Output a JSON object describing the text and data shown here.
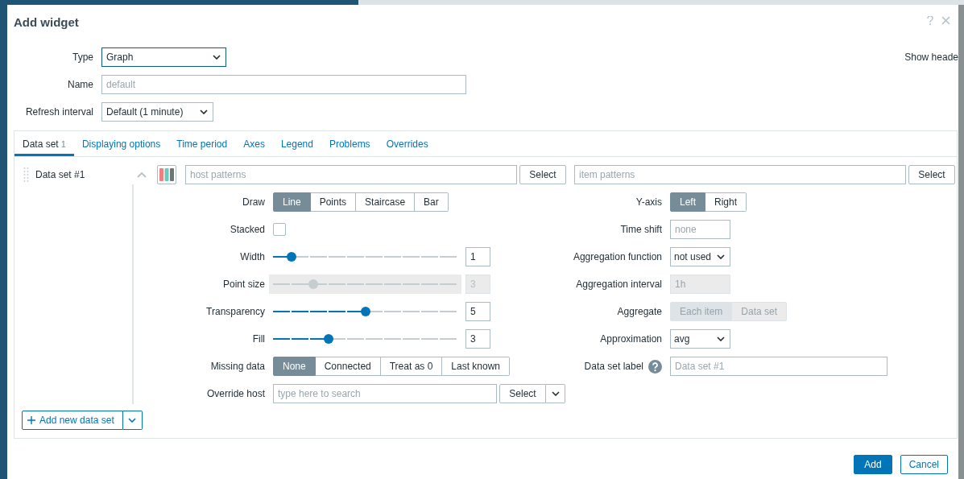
{
  "dialog": {
    "title": "Add widget"
  },
  "form": {
    "type": {
      "label": "Type",
      "value": "Graph"
    },
    "name": {
      "label": "Name",
      "placeholder": "default"
    },
    "refresh": {
      "label": "Refresh interval",
      "value": "Default (1 minute)"
    },
    "show_header": {
      "label": "Show heade"
    }
  },
  "tabs": [
    {
      "label": "Data set",
      "count": "1",
      "selected": true
    },
    {
      "label": "Displaying options",
      "selected": false
    },
    {
      "label": "Time period",
      "selected": false
    },
    {
      "label": "Axes",
      "selected": false
    },
    {
      "label": "Legend",
      "selected": false
    },
    {
      "label": "Problems",
      "selected": false
    },
    {
      "label": "Overrides",
      "selected": false
    }
  ],
  "data_sets": [
    {
      "label": "Data set #1",
      "expanded": true
    }
  ],
  "add_data_set": {
    "label": "Add new data set"
  },
  "data_set": {
    "host": {
      "placeholder": "host patterns",
      "button": "Select"
    },
    "item": {
      "placeholder": "item patterns",
      "button": "Select"
    },
    "left_fields": [
      {
        "kind": "segmented",
        "label": "Draw",
        "options": [
          {
            "label": "Line",
            "selected": true
          },
          {
            "label": "Points",
            "selected": false
          },
          {
            "label": "Staircase",
            "selected": false
          },
          {
            "label": "Bar",
            "selected": false
          }
        ]
      },
      {
        "kind": "checkbox",
        "label": "Stacked",
        "checked": false
      },
      {
        "kind": "slider",
        "label": "Width",
        "level": 0.1,
        "value": "1"
      },
      {
        "kind": "slider",
        "label": "Point size",
        "level": 0.22,
        "value": "3",
        "disabled": true
      },
      {
        "kind": "slider",
        "label": "Transparency",
        "level": 0.5,
        "value": "5"
      },
      {
        "kind": "slider",
        "label": "Fill",
        "level": 0.3,
        "value": "3"
      },
      {
        "kind": "segmented",
        "label": "Missing data",
        "options": [
          {
            "label": "None",
            "selected": true
          },
          {
            "label": "Connected",
            "selected": false
          },
          {
            "label": "Treat as 0",
            "selected": false
          },
          {
            "label": "Last known",
            "selected": false
          }
        ]
      },
      {
        "kind": "search",
        "label": "Override host",
        "placeholder": "type here to search",
        "button": "Select"
      }
    ],
    "right_fields": [
      {
        "kind": "segmented",
        "label": "Y-axis",
        "options": [
          {
            "label": "Left",
            "selected": true
          },
          {
            "label": "Right",
            "selected": false
          }
        ]
      },
      {
        "kind": "input",
        "label": "Time shift",
        "placeholder": "none"
      },
      {
        "kind": "select",
        "label": "Aggregation function",
        "value": "not used"
      },
      {
        "kind": "input",
        "label": "Aggregation interval",
        "placeholder": "1h",
        "disabled": true
      },
      {
        "kind": "segmented",
        "label": "Aggregate",
        "disabled": true,
        "options": [
          {
            "label": "Each item",
            "selected": true
          },
          {
            "label": "Data set",
            "selected": false
          }
        ]
      },
      {
        "kind": "select",
        "label": "Approximation",
        "value": "avg"
      },
      {
        "kind": "text",
        "label": "Data set label",
        "placeholder": "Data set #1",
        "help": true
      }
    ]
  },
  "footer": {
    "buttons": [
      {
        "label": "Add",
        "primary": true
      },
      {
        "label": "Cancel",
        "primary": false
      }
    ]
  }
}
